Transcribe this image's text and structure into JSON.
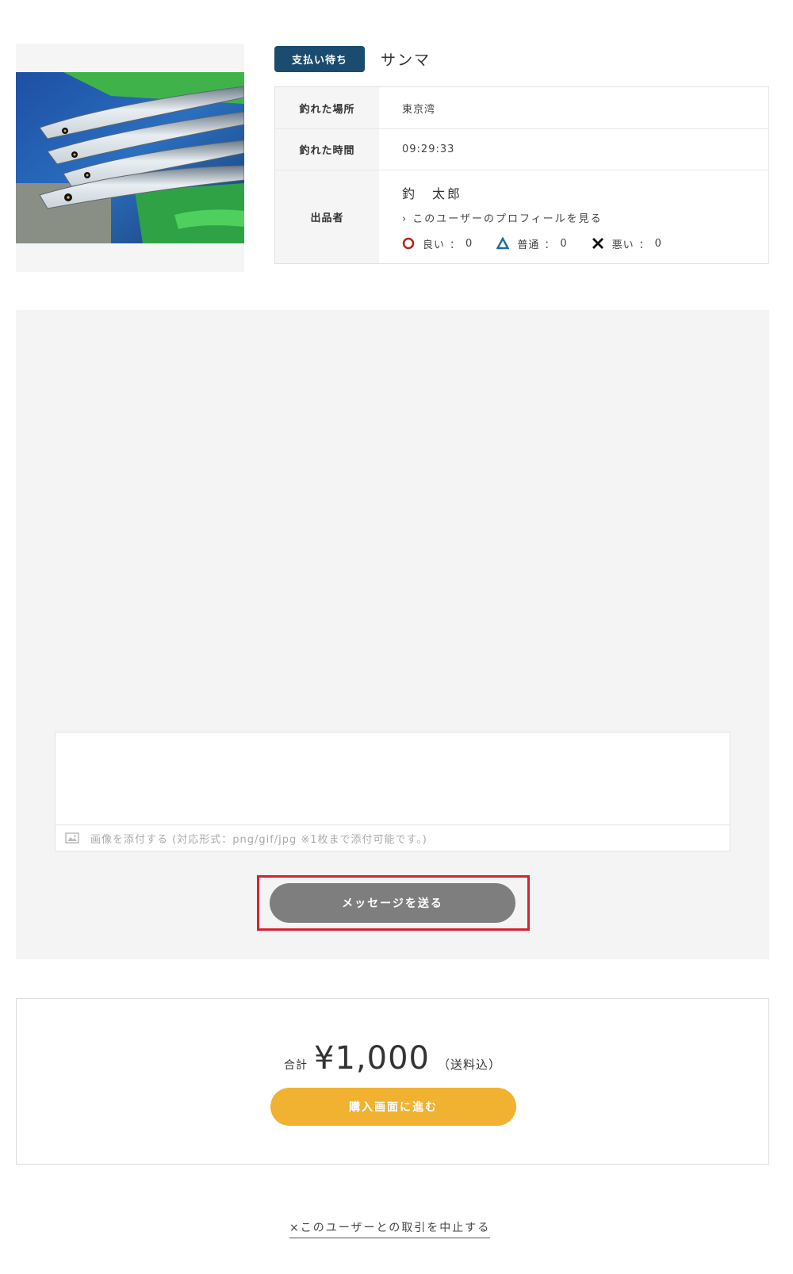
{
  "item": {
    "status_badge": "支払い待ち",
    "title": "サンマ",
    "image_alt": "saury-fish-photo"
  },
  "info": {
    "location_label": "釣れた場所",
    "location_value": "東京湾",
    "time_label": "釣れた時間",
    "time_value": "09:29:33",
    "seller_label": "出品者",
    "seller_name": "釣　太郎",
    "profile_link": "このユーザーのプロフィールを見る",
    "ratings": {
      "good_label": "良い",
      "good_count": "0",
      "normal_label": "普通",
      "normal_count": "0",
      "bad_label": "悪い",
      "bad_count": "0",
      "colon": "："
    }
  },
  "message": {
    "textarea_value": "",
    "attach_label": "画像を添付する (対応形式：png/gif/jpg ※1枚まで添付可能です。)",
    "send_button": "メッセージを送る"
  },
  "total": {
    "label": "合計",
    "amount": "¥1,000",
    "note": "（送料込）",
    "buy_button": "購入画面に進む"
  },
  "cancel_link": "×このユーザーとの取引を中止する",
  "colors": {
    "badge": "#1b4b6f",
    "send_button": "#7e7e7e",
    "buy_button": "#f0b230",
    "highlight": "#d8202f",
    "good": "#b2291d",
    "normal": "#1f6aa8",
    "bad": "#111111"
  }
}
